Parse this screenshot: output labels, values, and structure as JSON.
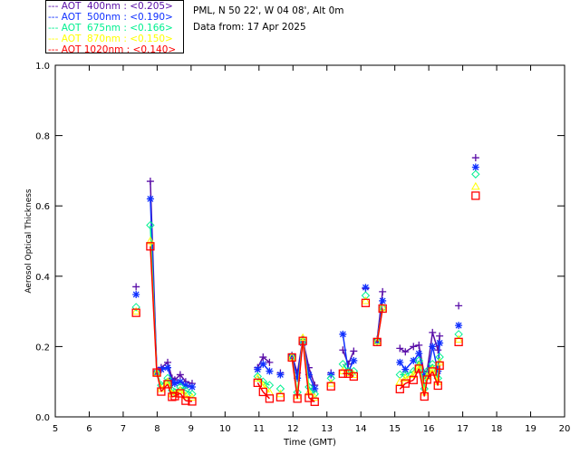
{
  "header": {
    "site": "PML, N 50 22', W 04 08', Alt 0m",
    "date_line": "Data from: 17 Apr 2025"
  },
  "chart_data": {
    "type": "scatter",
    "title": "",
    "xlabel": "Time (GMT)",
    "ylabel": "Aerosol Optical Thickness",
    "xlim": [
      5,
      20
    ],
    "ylim": [
      0.0,
      1.0
    ],
    "xticks": [
      "5",
      "6",
      "7",
      "8",
      "9",
      "10",
      "11",
      "12",
      "13",
      "14",
      "15",
      "16",
      "17",
      "18",
      "19",
      "20"
    ],
    "yticks": [
      "0.0",
      "0.2",
      "0.4",
      "0.6",
      "0.8",
      "1.0"
    ],
    "grid": false,
    "legend_placement": "top-left, outside plot",
    "x": [
      7.38,
      7.8,
      7.99,
      8.12,
      8.31,
      8.44,
      8.52,
      8.68,
      8.84,
      9.03,
      10.96,
      11.12,
      11.31,
      11.63,
      11.97,
      12.13,
      12.29,
      12.47,
      12.64,
      13.12,
      13.47,
      13.63,
      13.79,
      14.14,
      14.48,
      14.64,
      15.15,
      15.31,
      15.55,
      15.71,
      15.87,
      15.95,
      16.11,
      16.27,
      16.32,
      16.88,
      17.38
    ],
    "series": [
      {
        "name": "AOT  400nm : <0.205>",
        "marker": "plus",
        "color": "#5a0fa8",
        "values": [
          0.37,
          0.67,
          0.13,
          0.14,
          0.155,
          0.11,
          0.105,
          0.12,
          0.1,
          0.095,
          0.14,
          0.17,
          0.155,
          0.125,
          0.175,
          0.125,
          0.22,
          0.14,
          0.09,
          0.125,
          0.19,
          0.15,
          0.187,
          0.365,
          0.22,
          0.356,
          0.195,
          0.185,
          0.2,
          0.204,
          0.12,
          0.13,
          0.24,
          0.19,
          0.23,
          0.316,
          0.737
        ]
      },
      {
        "name": "AOT  500nm : <0.190>",
        "marker": "asterisk",
        "color": "#1030ff",
        "values": [
          0.348,
          0.62,
          0.125,
          0.135,
          0.14,
          0.1,
          0.095,
          0.1,
          0.09,
          0.085,
          0.135,
          0.15,
          0.13,
          0.12,
          0.17,
          0.11,
          0.21,
          0.12,
          0.08,
          0.12,
          0.235,
          0.13,
          0.16,
          0.368,
          0.215,
          0.33,
          0.155,
          0.135,
          0.16,
          0.18,
          0.115,
          0.115,
          0.2,
          0.13,
          0.21,
          0.26,
          0.71
        ]
      },
      {
        "name": "AOT  675nm : <0.166>",
        "marker": "diamond",
        "color": "#00f090",
        "values": [
          0.312,
          0.545,
          0.125,
          0.09,
          0.11,
          0.075,
          0.07,
          0.085,
          0.075,
          0.065,
          0.115,
          0.1,
          0.09,
          0.08,
          0.17,
          0.07,
          0.215,
          0.085,
          0.065,
          0.11,
          0.15,
          0.13,
          0.13,
          0.345,
          0.215,
          0.31,
          0.12,
          0.12,
          0.13,
          0.16,
          0.08,
          0.13,
          0.15,
          0.11,
          0.17,
          0.235,
          0.69
        ]
      },
      {
        "name": "AOT  870nm : <0.150>",
        "marker": "triangle",
        "color": "#ffff00",
        "values": [
          0.3,
          0.5,
          0.125,
          0.08,
          0.1,
          0.065,
          0.065,
          0.075,
          0.06,
          0.055,
          0.11,
          0.09,
          0.07,
          0.065,
          0.17,
          0.06,
          0.225,
          0.07,
          0.055,
          0.095,
          0.13,
          0.125,
          0.12,
          0.33,
          0.215,
          0.31,
          0.1,
          0.11,
          0.12,
          0.145,
          0.07,
          0.115,
          0.135,
          0.1,
          0.155,
          0.22,
          0.655
        ]
      },
      {
        "name": "AOT 1020nm : <0.140>",
        "marker": "square",
        "color": "#ff0000",
        "values": [
          0.296,
          0.485,
          0.126,
          0.072,
          0.093,
          0.057,
          0.059,
          0.067,
          0.046,
          0.044,
          0.097,
          0.071,
          0.052,
          0.056,
          0.169,
          0.052,
          0.216,
          0.054,
          0.043,
          0.087,
          0.123,
          0.123,
          0.115,
          0.324,
          0.213,
          0.308,
          0.079,
          0.095,
          0.105,
          0.137,
          0.058,
          0.106,
          0.129,
          0.089,
          0.146,
          0.213,
          0.629
        ]
      }
    ]
  }
}
